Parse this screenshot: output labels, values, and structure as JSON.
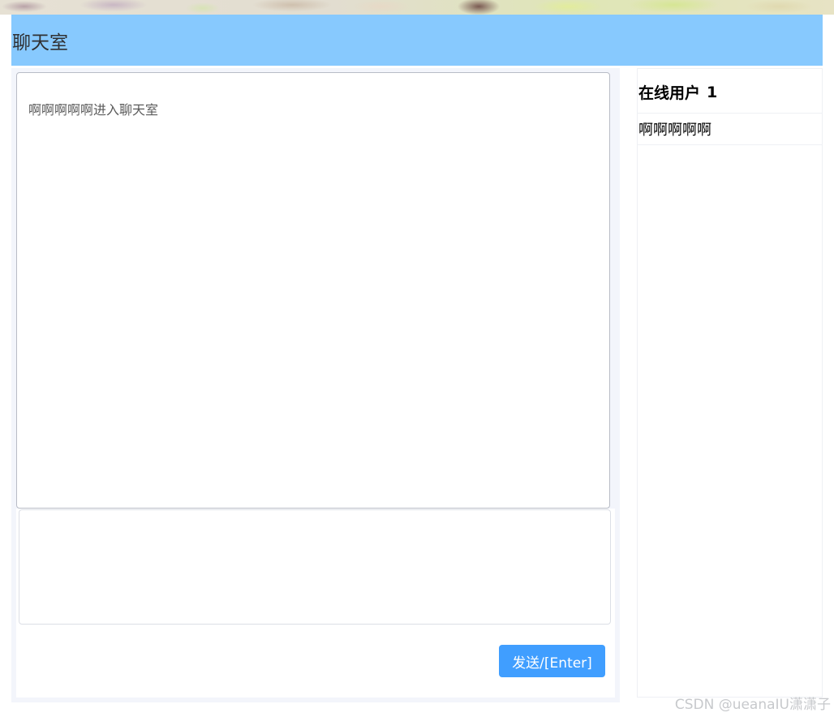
{
  "header": {
    "title": "聊天室"
  },
  "chat": {
    "messages": [
      {
        "text": "啊啊啊啊啊进入聊天室"
      }
    ],
    "compose": {
      "value": "",
      "placeholder": ""
    },
    "send_label": "发送/[Enter]"
  },
  "users": {
    "title": "在线用户",
    "count": "1",
    "items": [
      {
        "name": "啊啊啊啊啊"
      }
    ]
  },
  "watermark": {
    "text": "CSDN @ueanaIU潇潇子"
  },
  "colors": {
    "header_bg": "#87c9fe",
    "send_button_bg": "#409eff",
    "panel_bg": "#f3f5fb"
  }
}
